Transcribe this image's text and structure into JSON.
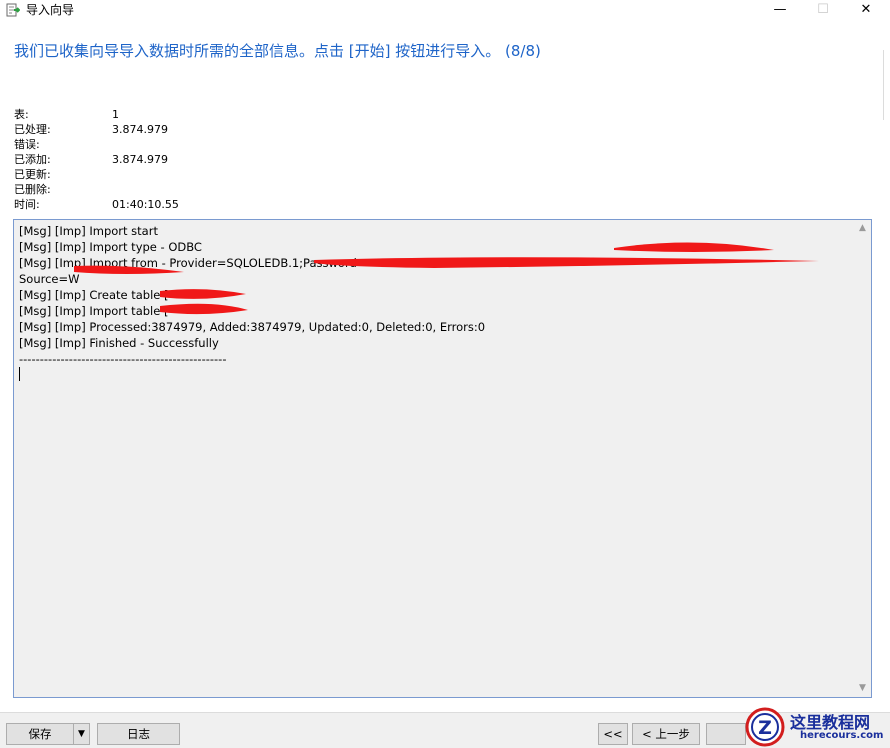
{
  "window": {
    "title": "导入向导",
    "min_glyph": "—",
    "max_glyph": "☐",
    "close_glyph": "✕"
  },
  "heading": "我们已收集向导导入数据时所需的全部信息。点击 [开始] 按钮进行导入。 (8/8)",
  "stats": [
    {
      "label": "表:",
      "value": "1"
    },
    {
      "label": "已处理:",
      "value": "3.874.979"
    },
    {
      "label": "错误:",
      "value": ""
    },
    {
      "label": "已添加:",
      "value": "3.874.979"
    },
    {
      "label": "已更新:",
      "value": ""
    },
    {
      "label": "已删除:",
      "value": ""
    },
    {
      "label": "时间:",
      "value": "01:40:10.55"
    }
  ],
  "log": {
    "lines": [
      "[Msg] [Imp] Import start",
      "[Msg] [Imp] Import type - ODBC",
      "[Msg] [Imp] Import from - Provider=SQLOLEDB.1;Password=",
      "Source=W",
      "[Msg] [Imp] Create table [",
      "[Msg] [Imp] Import table [",
      "[Msg] [Imp] Processed:3874979, Added:3874979, Updated:0, Deleted:0, Errors:0",
      "[Msg] [Imp] Finished - Successfully",
      "--------------------------------------------------"
    ]
  },
  "buttons": {
    "save": "保存",
    "save_dropdown": "▼",
    "log": "日志",
    "first": "<<",
    "prev": "< 上一步",
    "next": ""
  },
  "watermark": {
    "title": "这里教程网",
    "url": "herecours.com",
    "badge_letter": "Z"
  },
  "colors": {
    "heading": "#1e64c8",
    "redaction": "#f01818",
    "log_background": "#f0f0f0"
  }
}
